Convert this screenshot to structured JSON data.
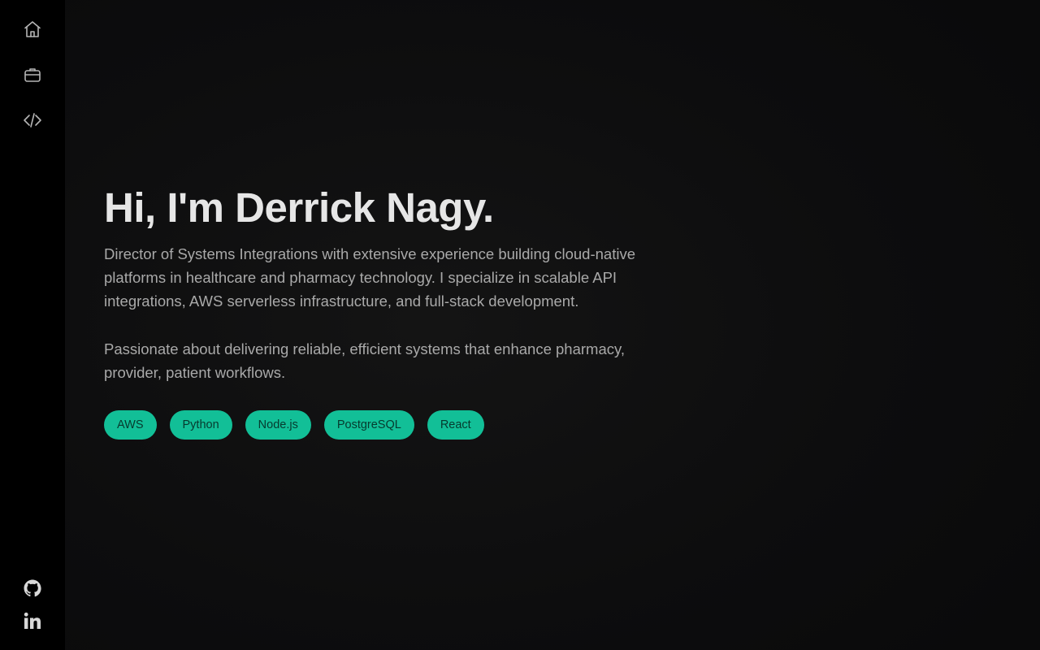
{
  "sidebar": {
    "nav": [
      {
        "icon": "home-icon"
      },
      {
        "icon": "briefcase-icon"
      },
      {
        "icon": "code-icon"
      }
    ],
    "social": [
      {
        "icon": "github-icon"
      },
      {
        "icon": "linkedin-icon"
      }
    ]
  },
  "hero": {
    "title": "Hi, I'm Derrick Nagy.",
    "paragraph1": "Director of Systems Integrations with extensive experience building cloud-native platforms in healthcare and pharmacy technology. I specialize in scalable API integrations, AWS serverless infrastructure, and full-stack development.",
    "paragraph2": "Passionate about delivering reliable, efficient systems that enhance pharmacy, provider, patient workflows.",
    "tags": [
      "AWS",
      "Python",
      "Node.js",
      "PostgreSQL",
      "React"
    ]
  },
  "colors": {
    "accent": "#12bf97",
    "sidebar_bg": "#000000",
    "page_bg": "#0b0b0c"
  }
}
